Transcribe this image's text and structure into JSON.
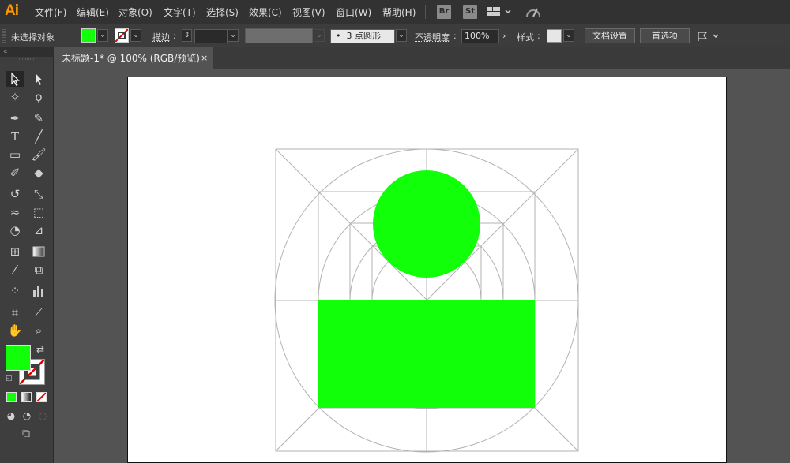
{
  "app": {
    "logo": "Ai"
  },
  "menu": [
    "文件(F)",
    "编辑(E)",
    "对象(O)",
    "文字(T)",
    "选择(S)",
    "效果(C)",
    "视图(V)",
    "窗口(W)",
    "帮助(H)"
  ],
  "menubar_icons": {
    "bridge": "Br",
    "stock": "St"
  },
  "options": {
    "selection_status": "未选择对象",
    "stroke_label": "描边",
    "brush_value": "3 点圆形",
    "opacity_label": "不透明度",
    "opacity_value": "100%",
    "style_label": "样式",
    "doc_setup_button": "文档设置",
    "preferences_button": "首选项"
  },
  "document": {
    "tab_title": "未标题-1* @ 100% (RGB/预览)",
    "close_glyph": "×"
  },
  "colors": {
    "fill": "#11ff08",
    "guide": "#b3b3b3",
    "stroke_none": "#e00000",
    "brand": "#ff9a00"
  },
  "tools": [
    "selection-tool-icon",
    "direct-selection-tool-icon",
    "magic-wand-tool-icon",
    "lasso-tool-icon",
    "pen-tool-icon",
    "curvature-tool-icon",
    "type-tool-icon",
    "line-segment-tool-icon",
    "rectangle-tool-icon",
    "paintbrush-tool-icon",
    "shaper-tool-icon",
    "eraser-tool-icon",
    "rotate-tool-icon",
    "scale-tool-icon",
    "width-tool-icon",
    "free-transform-tool-icon",
    "shape-builder-tool-icon",
    "perspective-grid-tool-icon",
    "mesh-tool-icon",
    "gradient-tool-icon",
    "eyedropper-tool-icon",
    "blend-tool-icon",
    "symbol-sprayer-tool-icon",
    "column-graph-tool-icon",
    "artboard-tool-icon",
    "slice-tool-icon",
    "hand-tool-icon",
    "zoom-tool-icon"
  ]
}
